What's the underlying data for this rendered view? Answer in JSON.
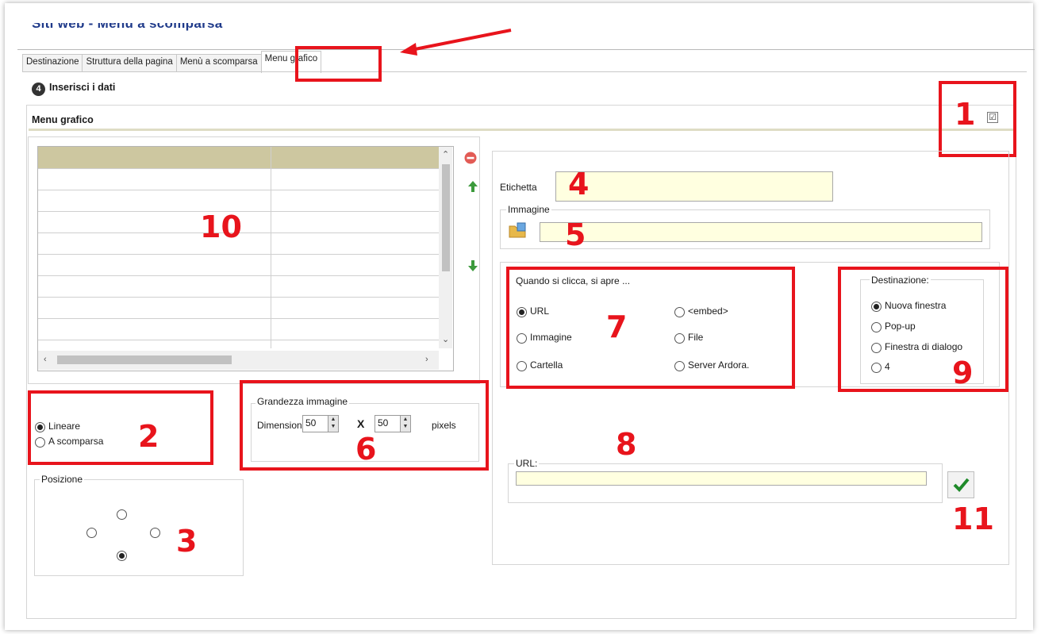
{
  "window_title": "Siti web - Menu a scomparsa",
  "tabs": [
    {
      "label": "Destinazione"
    },
    {
      "label": "Struttura della pagina"
    },
    {
      "label": "Menù a scomparsa"
    },
    {
      "label": "Menu grafico"
    }
  ],
  "step": {
    "number": "4",
    "label": "Inserisci i dati"
  },
  "section_title": "Menu grafico",
  "checkbox_mark": "☑",
  "fields": {
    "etichetta_label": "Etichetta",
    "etichetta_value": "",
    "immagine_legend": "Immagine",
    "immagine_value": ""
  },
  "open_group": {
    "legend": "Quando si clicca, si apre ...",
    "options": [
      {
        "label": "URL",
        "selected": true
      },
      {
        "label": "<embed>",
        "selected": false
      },
      {
        "label": "Immagine",
        "selected": false
      },
      {
        "label": "File",
        "selected": false
      },
      {
        "label": "Cartella",
        "selected": false
      },
      {
        "label": "Server Ardora.",
        "selected": false
      }
    ]
  },
  "destination_group": {
    "legend": "Destinazione:",
    "options": [
      {
        "label": "Nuova finestra",
        "selected": true
      },
      {
        "label": "Pop-up",
        "selected": false
      },
      {
        "label": "Finestra di dialogo",
        "selected": false
      },
      {
        "label": "4",
        "selected": false
      }
    ]
  },
  "url_group": {
    "legend": "URL:",
    "value": ""
  },
  "layout_group": {
    "options": [
      {
        "label": "Lineare",
        "selected": true
      },
      {
        "label": "A scomparsa",
        "selected": false
      }
    ]
  },
  "image_size": {
    "legend": "Grandezza immagine",
    "dim_label": "Dimensioni",
    "width": "50",
    "times": "X",
    "height": "50",
    "unit": "pixels"
  },
  "position_legend": "Posizione",
  "annotations": [
    "1",
    "2",
    "3",
    "4",
    "5",
    "6",
    "7",
    "8",
    "9",
    "10",
    "11"
  ],
  "colors": {
    "annotation_red": "#e8141c",
    "field_yellow": "#ffffe0",
    "grid_header": "#cdc7a0"
  },
  "icons": [
    "remove-icon",
    "move-up-icon",
    "move-down-icon",
    "folder-image-icon",
    "checkmark-icon",
    "arrow-annotation"
  ]
}
